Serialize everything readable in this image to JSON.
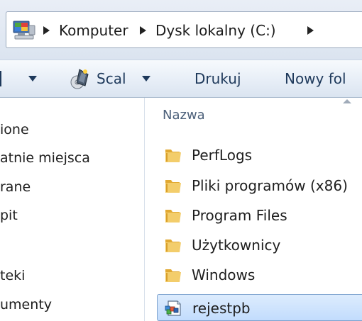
{
  "address": {
    "crumbs": [
      "Komputer",
      "Dysk lokalny (C:)"
    ]
  },
  "toolbar": {
    "organize_partial": "",
    "burn_label": "Scal",
    "print_label": "Drukuj",
    "new_folder_label": "Nowy fol"
  },
  "nav": {
    "items": [
      "ione",
      "atnie miejsca",
      "rane",
      "pit",
      "teki",
      "umenty"
    ]
  },
  "filelist": {
    "column_name": "Nazwa",
    "items": [
      {
        "name": "PerfLogs",
        "icon": "folder-icon"
      },
      {
        "name": "Pliki programów (x86)",
        "icon": "folder-icon"
      },
      {
        "name": "Program Files",
        "icon": "folder-icon"
      },
      {
        "name": "Użytkownicy",
        "icon": "folder-icon"
      },
      {
        "name": "Windows",
        "icon": "folder-icon"
      },
      {
        "name": "rejestpb",
        "icon": "registry-file-icon"
      }
    ]
  },
  "colors": {
    "command_text": "#1e395b",
    "selection_fill": "#c2dcfd",
    "selection_border": "#7da2ce",
    "folder": "#e8b64a"
  }
}
